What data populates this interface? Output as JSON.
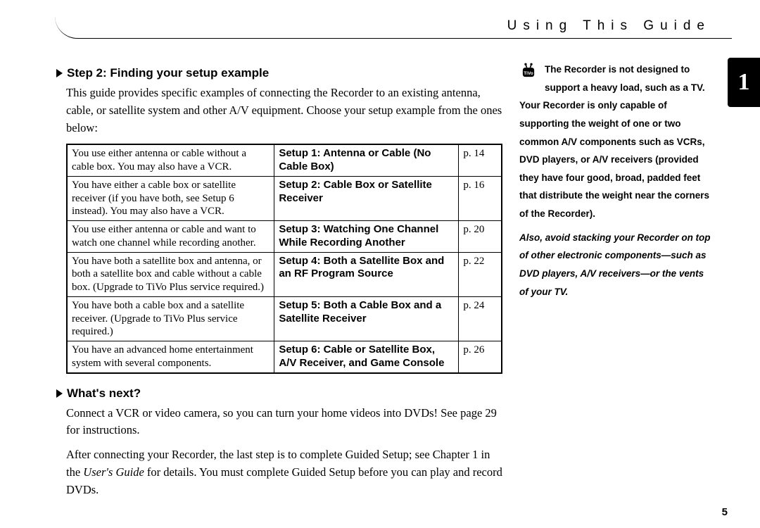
{
  "header": {
    "title": "Using This Guide"
  },
  "chapter_tab": "1",
  "page_number": "5",
  "section_step2": {
    "heading": "Step 2: Finding your setup example",
    "body": "This guide provides specific examples of connecting the Recorder to an existing antenna, cable, or satellite system and other A/V equipment. Choose your setup example from the ones below:"
  },
  "setup_table": [
    {
      "desc": "You use either antenna or cable without a cable box. You may also have a VCR.",
      "title": "Setup 1: Antenna or Cable (No Cable Box)",
      "page": "p. 14"
    },
    {
      "desc": "You have either a cable box or satellite receiver (if you have both, see Setup 6 instead). You may also have a VCR.",
      "title": "Setup 2: Cable Box or Satellite Receiver",
      "page": "p. 16"
    },
    {
      "desc": "You use either antenna or cable and want to watch one channel while recording another.",
      "title": "Setup 3: Watching One Channel While Recording Another",
      "page": "p. 20"
    },
    {
      "desc": "You have both a satellite box and antenna, or both a satellite box and cable without a cable box. (Upgrade to TiVo Plus service required.)",
      "title": "Setup 4: Both a Satellite Box and an RF Program Source",
      "page": "p. 22"
    },
    {
      "desc": "You have both a cable box and a satellite receiver. (Upgrade to TiVo Plus service required.)",
      "title": "Setup 5: Both a Cable Box and a Satellite Receiver",
      "page": "p. 24"
    },
    {
      "desc": "You have an advanced home entertainment system with several components.",
      "title": "Setup 6: Cable or Satellite Box, A/V Receiver, and Game Console",
      "page": "p. 26"
    }
  ],
  "section_next": {
    "heading": "What's next?",
    "body1": "Connect a VCR or video camera, so you can turn your home videos into DVDs! See page 29 for instructions.",
    "body2_pre": "After connecting your Recorder, the last step is to complete Guided Setup; see Chapter 1 in the ",
    "body2_italic": "User's Guide",
    "body2_post": " for details. You must complete Guided Setup before you can play and record DVDs."
  },
  "sidebar": {
    "bold_intro": "The Recorder is not designed to support a heavy load, such as a TV.",
    "main": " Your Recorder is only capable of supporting the weight of one or two common A/V components such as VCRs, DVD players, or A/V receivers (provided they have four good, broad, padded feet that distribute the weight near the corners of the Recorder).",
    "italic": "Also, avoid stacking your Recorder on top of other electronic components—such as DVD players, A/V receivers—or the vents of your TV."
  }
}
